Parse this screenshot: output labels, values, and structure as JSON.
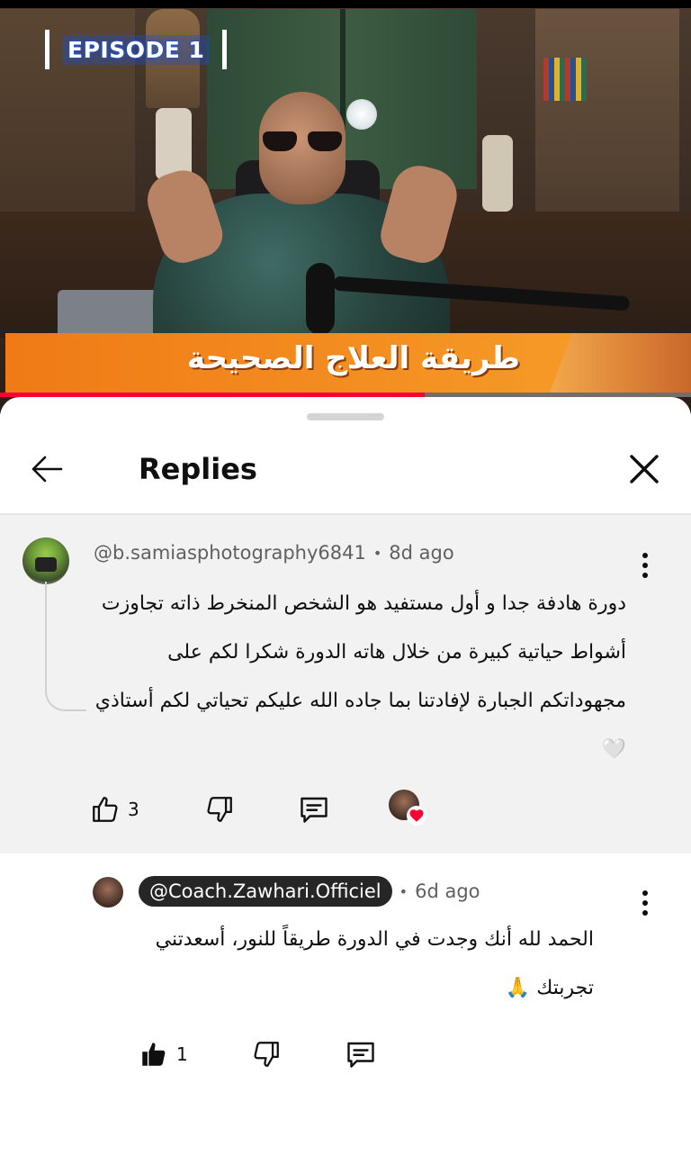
{
  "video": {
    "episode_label": "EPISODE 1",
    "banner_text": "طريقة العلاج الصحيحة",
    "progress": 0.615
  },
  "header": {
    "title": "Replies"
  },
  "parent_comment": {
    "author": "@b.samiasphotography6841",
    "time": "8d ago",
    "text": "دورة هادفة جدا و أول مستفيد هو الشخص المنخرط ذاته تجاوزت أشواط حياتية كبيرة من خلال هاته الدورة شكرا لكم على مجهوداتكم الجبارة لإفادتنا بما جاده الله عليكم تحياتي لكم أستاذي 🤍",
    "like_count": "3",
    "liked": false,
    "hearted_by_creator": true
  },
  "reply": {
    "author": "@Coach.Zawhari.Officiel",
    "time": "6d ago",
    "text": "الحمد لله أنك وجدت في الدورة طريقاً للنور، أسعدتني تجربتك 🙏",
    "like_count": "1",
    "liked": true
  },
  "colors": {
    "accent_progress": "#ff0033",
    "heart": "#ff0033",
    "parent_bg": "#f2f2f2",
    "creator_badge_bg": "#262626"
  },
  "icons": [
    "back-arrow-icon",
    "close-icon",
    "more-vert-icon",
    "thumbs-up-icon",
    "thumbs-down-icon",
    "reply-icon",
    "creator-heart-icon"
  ]
}
